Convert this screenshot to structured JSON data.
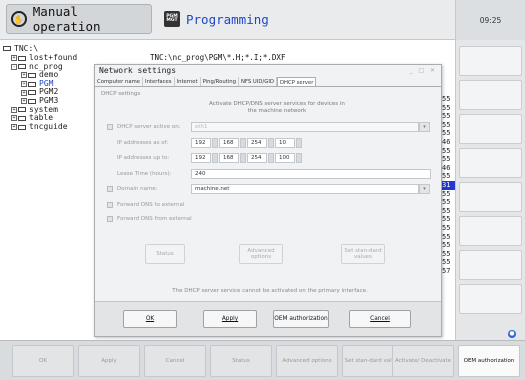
{
  "header": {
    "mode_manual": "Manual operation",
    "mode_programming": "Programming",
    "pgm_icon_line1": "PGM",
    "pgm_icon_line2": "MGT",
    "clock": "09:25"
  },
  "file_manager": {
    "tree_root": "TNC:\\",
    "tree": [
      "lost+found",
      "nc_prog",
      "demo",
      "PGM",
      "PGM2",
      "PGM3",
      "system",
      "table",
      "tncguide"
    ],
    "path": "TNC:\\nc_prog\\PGM\\*.H;*.I;*.DXF",
    "numbers": [
      "55",
      "55",
      "55",
      "55",
      "55",
      "46",
      "55",
      "55",
      "46",
      "55",
      "31",
      "55",
      "55",
      "55",
      "55",
      "55",
      "55",
      "55",
      "55",
      "55",
      "57"
    ]
  },
  "dialog": {
    "title": "Network settings",
    "tabs": [
      "Computer name",
      "Interfaces",
      "Internet",
      "Ping/Routing",
      "NFS UID/GID",
      "DHCP server"
    ],
    "section_title": "DHCP settings",
    "description": "Activate DHCP/DNS server services for devices in the machine network",
    "server_active_label": "DHCP server active on:",
    "server_active_value": "eth1",
    "ip_from_label": "IP addresses as of:",
    "ip_from": [
      "192",
      "168",
      "254",
      "10"
    ],
    "ip_to_label": "IP addresses up to:",
    "ip_to": [
      "192",
      "168",
      "254",
      "100"
    ],
    "lease_label": "Lease Time (hours):",
    "lease_value": "240",
    "domain_label": "Domain name:",
    "domain_value": "machine.net",
    "forward_dns_external": "Forward DNS to external",
    "forward_dns_from_external": "Forward DNS from external",
    "btn_status": "Status",
    "btn_advanced": "Advanced options",
    "btn_standard": "Set stan-dard values",
    "status_message": "The DHCP server service cannot be activated on the primary interface.",
    "btn_ok": "OK",
    "btn_apply": "Apply",
    "btn_oem": "OEM authorization",
    "btn_cancel": "Cancel"
  },
  "softkeys": [
    "OK",
    "Apply",
    "Cancel",
    "Status",
    "Advanced options",
    "Set stan-dard values",
    "Activate/ Deactivate",
    "OEM authorization"
  ],
  "colors": {
    "accent_blue": "#2338d0",
    "programming_text": "#1f47c8"
  }
}
